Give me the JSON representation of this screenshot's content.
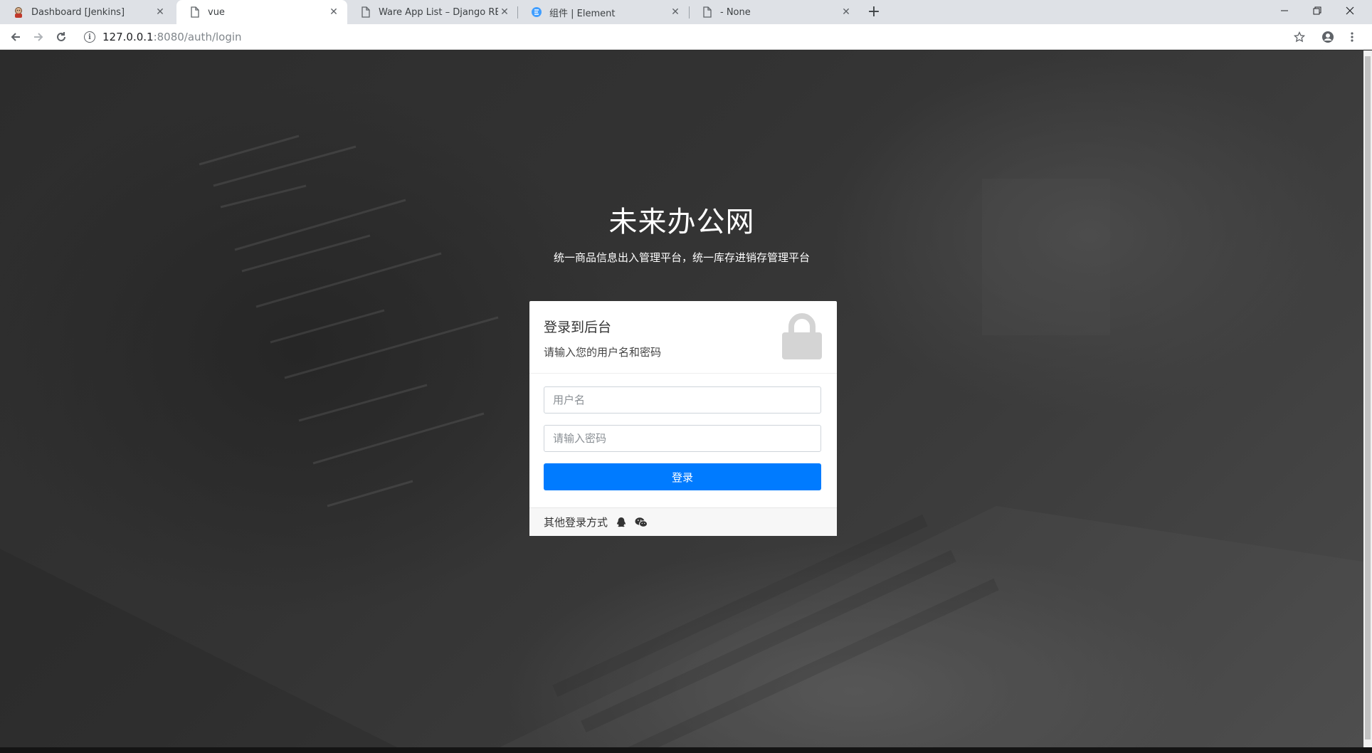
{
  "browser": {
    "tabs": [
      {
        "title": "Dashboard [Jenkins]",
        "icon": "jenkins-icon",
        "active": false
      },
      {
        "title": "vue",
        "icon": "page-icon",
        "active": true
      },
      {
        "title": "Ware App List – Django REST f",
        "icon": "page-icon",
        "active": false
      },
      {
        "title": "组件 | Element",
        "icon": "element-icon",
        "active": false
      },
      {
        "title": "- None",
        "icon": "page-icon",
        "active": false
      }
    ],
    "close_glyph": "✕",
    "new_tab_glyph": "+",
    "url_host": "127.0.0.1",
    "url_path": ":8080/auth/login"
  },
  "page": {
    "title": "未来办公网",
    "subtitle": "统一商品信息出入管理平台，统一库存进销存管理平台"
  },
  "login": {
    "heading": "登录到后台",
    "description": "请输入您的用户名和密码",
    "username_placeholder": "用户名",
    "password_placeholder": "请输入密码",
    "submit_label": "登录",
    "other_methods_label": "其他登录方式",
    "other_methods_icons": [
      "qq-icon",
      "wechat-icon"
    ]
  },
  "colors": {
    "primary": "#007bff",
    "chrome_bg": "#dee1e6"
  }
}
